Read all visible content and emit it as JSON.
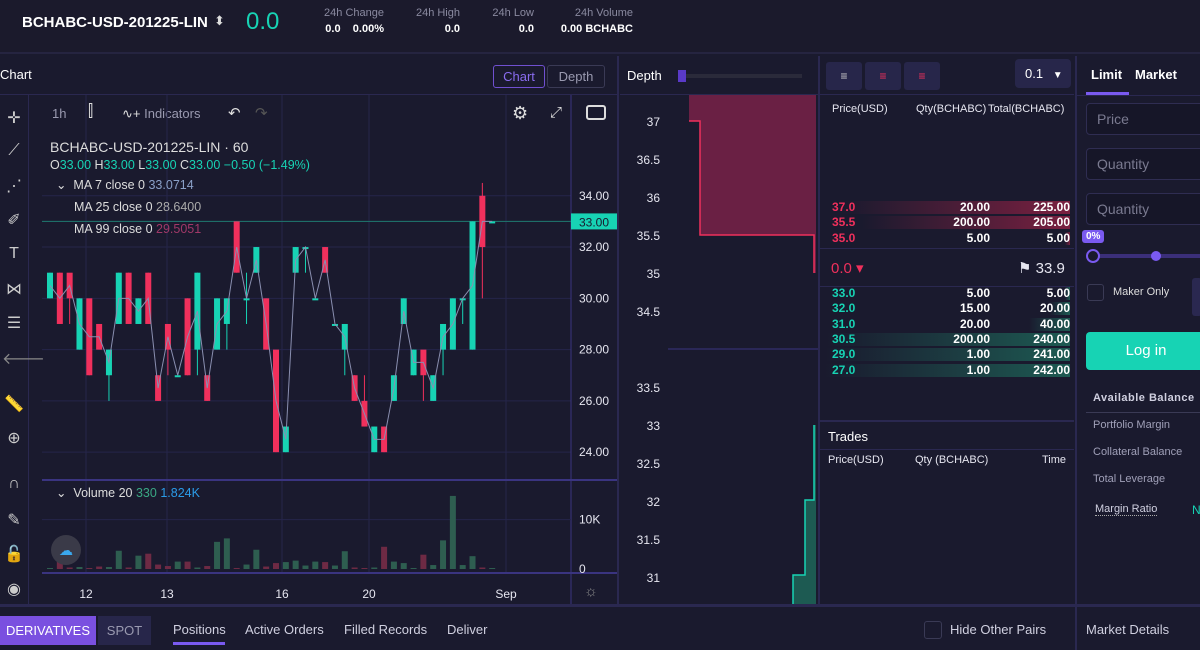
{
  "header": {
    "symbol": "BCHABC-USD-201225-LIN",
    "last_price": "0.0",
    "stats": [
      {
        "label": "24h Change",
        "values": [
          "0.0",
          "0.00%"
        ]
      },
      {
        "label": "24h High",
        "values": [
          "0.0"
        ]
      },
      {
        "label": "24h Low",
        "values": [
          "0.0"
        ]
      },
      {
        "label": "24h Volume",
        "values": [
          "0.00 BCHABC"
        ]
      }
    ]
  },
  "chart_panel": {
    "title": "Chart",
    "toggles": [
      "Chart",
      "Depth"
    ],
    "active_toggle": "Chart",
    "toolbar": {
      "interval": "1h",
      "indicators": "Indicators"
    },
    "legend": {
      "title": "BCHABC-USD-201225-LIN",
      "interval": "60",
      "o": "33.00",
      "h": "33.00",
      "l": "33.00",
      "c": "33.00",
      "change": "−0.50 (−1.49%)",
      "ma": [
        {
          "label": "MA 7 close 0",
          "value": "33.0714"
        },
        {
          "label": "MA 25 close 0",
          "value": "28.6400"
        },
        {
          "label": "MA 99 close 0",
          "value": "29.5051"
        }
      ],
      "volume": {
        "label": "Volume 20",
        "v1": "330",
        "v2": "1.824K"
      }
    },
    "price_axis": [
      "34.00",
      "32.00",
      "30.00",
      "28.00",
      "26.00",
      "24.00"
    ],
    "current_price_tag": "33.00",
    "volume_axis": [
      "10K",
      "0"
    ],
    "time_axis": [
      "12",
      "13",
      "16",
      "20",
      "Sep"
    ]
  },
  "chart_data": {
    "type": "candlestick",
    "ylim": [
      23.5,
      35.2
    ],
    "candles": [
      [
        30,
        31,
        30,
        31
      ],
      [
        31,
        31,
        29,
        29
      ],
      [
        31,
        30,
        29,
        30
      ],
      [
        28,
        30,
        28,
        30
      ],
      [
        30,
        29,
        27,
        27
      ],
      [
        29,
        29,
        28,
        28
      ],
      [
        27,
        28,
        26,
        28
      ],
      [
        29,
        31,
        29,
        31
      ],
      [
        31,
        31,
        29,
        29
      ],
      [
        29,
        30,
        29,
        30
      ],
      [
        31,
        31,
        29,
        29
      ],
      [
        27,
        27,
        26,
        26
      ],
      [
        29,
        29,
        27,
        28
      ],
      [
        27,
        27,
        27,
        27
      ],
      [
        30,
        30,
        27,
        27
      ],
      [
        28,
        31,
        27,
        31
      ],
      [
        27,
        27,
        26,
        26
      ],
      [
        28,
        30,
        28,
        30
      ],
      [
        29,
        30,
        28,
        30
      ],
      [
        33,
        33,
        31,
        31
      ],
      [
        30,
        31,
        29,
        30
      ],
      [
        31,
        32,
        31,
        32
      ],
      [
        30,
        30,
        28,
        28
      ],
      [
        28,
        27,
        24,
        24
      ],
      [
        24,
        24,
        25,
        25
      ],
      [
        31,
        32,
        31,
        32
      ],
      [
        32,
        32,
        31,
        32
      ],
      [
        30,
        30,
        30,
        30
      ],
      [
        32,
        32,
        31,
        31
      ],
      [
        29,
        29,
        29,
        29
      ],
      [
        28,
        29,
        27,
        29
      ],
      [
        27,
        27,
        26,
        26
      ],
      [
        26,
        27,
        25,
        25
      ],
      [
        24,
        25,
        24,
        25
      ],
      [
        25,
        25,
        24,
        24
      ],
      [
        26,
        27,
        26,
        27
      ],
      [
        29,
        30,
        29,
        30
      ],
      [
        27,
        27,
        28,
        28
      ],
      [
        28,
        27,
        26,
        27
      ],
      [
        26,
        27,
        26,
        27
      ],
      [
        28,
        29,
        27,
        29
      ],
      [
        28,
        30,
        28,
        30
      ],
      [
        30,
        30,
        29,
        30
      ],
      [
        28,
        33,
        28,
        33
      ],
      [
        34,
        34.5,
        30,
        32
      ],
      [
        33,
        33,
        33,
        33
      ]
    ],
    "volume": [
      0.2,
      1.5,
      0.3,
      0.4,
      0.2,
      0.5,
      0.4,
      3.7,
      0.3,
      2.7,
      3.1,
      0.9,
      0.6,
      1.5,
      1.5,
      0.3,
      0.6,
      5.5,
      6.2,
      0.2,
      0.9,
      3.9,
      0.5,
      1.2,
      1.4,
      1.7,
      0.7,
      1.5,
      1.4,
      0.7,
      3.6,
      0.3,
      0.2,
      0.3,
      4.5,
      1.5,
      1.2,
      0.2,
      2.9,
      0.8,
      5.8,
      14.8,
      0.8,
      2.6,
      0.3,
      0.2
    ]
  },
  "depth": {
    "title": "Depth",
    "y_axis": [
      "37",
      "36.5",
      "36",
      "35.5",
      "35",
      "34.5",
      "33.5",
      "33",
      "32.5",
      "32",
      "31.5",
      "31"
    ]
  },
  "orderbook": {
    "precision": "0.1",
    "headers": [
      "Price(USD)",
      "Qty(BCHABC)",
      "Total(BCHABC)"
    ],
    "asks": [
      [
        "37.0",
        "20.00",
        "225.00"
      ],
      [
        "35.5",
        "200.00",
        "205.00"
      ],
      [
        "35.0",
        "5.00",
        "5.00"
      ]
    ],
    "mid": {
      "last": "0.0",
      "mark": "33.9"
    },
    "bids": [
      [
        "33.0",
        "5.00",
        "5.00"
      ],
      [
        "32.0",
        "15.00",
        "20.00"
      ],
      [
        "31.0",
        "20.00",
        "40.00"
      ],
      [
        "30.5",
        "200.00",
        "240.00"
      ],
      [
        "29.0",
        "1.00",
        "241.00"
      ],
      [
        "27.0",
        "1.00",
        "242.00"
      ]
    ]
  },
  "trades": {
    "title": "Trades",
    "headers": [
      "Price(USD)",
      "Qty (BCHABC)",
      "Time"
    ]
  },
  "order_form": {
    "tabs": [
      "Limit",
      "Market"
    ],
    "price_placeholder": "Price",
    "qty_placeholder": "Quantity",
    "qty2_placeholder": "Quantity",
    "slider_pct": "0%",
    "maker_only": "Maker Only",
    "login": "Log in",
    "balance_title": "Available Balance",
    "balance_rows": [
      "Portfolio Margin",
      "Collateral Balance",
      "Total Leverage",
      "Margin Ratio"
    ],
    "margin_ratio_value": "N"
  },
  "bottom": {
    "market_tabs": [
      "DERIVATIVES",
      "SPOT"
    ],
    "tabs": [
      "Positions",
      "Active Orders",
      "Filled Records",
      "Deliver"
    ],
    "hide_pairs": "Hide Other Pairs",
    "market_details": "Market Details"
  },
  "colors": {
    "up": "#17d3b4",
    "down": "#f0305c",
    "accent": "#7050e0"
  }
}
